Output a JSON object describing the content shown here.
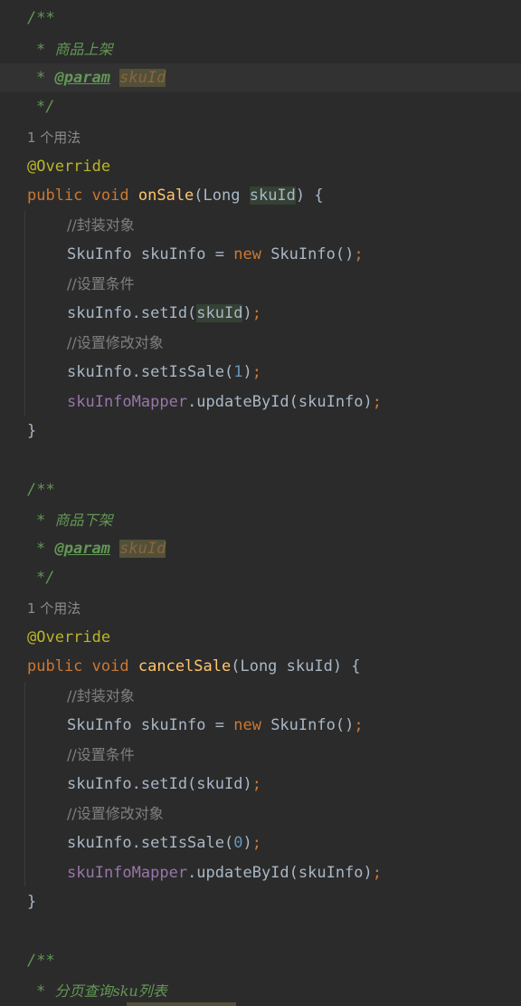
{
  "editor": {
    "block1": {
      "doc_open": "/**",
      "doc_desc": "商品上架",
      "doc_tag": "@param",
      "doc_param": "skuId",
      "doc_close": "*/",
      "usage": "1 个用法",
      "annotation": "@Override",
      "sig_kw1": "public",
      "sig_kw2": "void",
      "sig_name": "onSale",
      "sig_params_pre": "(Long ",
      "sig_param": "skuId",
      "sig_end": ") {",
      "c1": "//封装对象",
      "l1_a": "SkuInfo skuInfo = ",
      "l1_new": "new",
      "l1_b": " SkuInfo()",
      "c2": "//设置条件",
      "l2_a": "skuInfo.setId(",
      "l2_arg": "skuId",
      "l2_b": ")",
      "c3": "//设置修改对象",
      "l3_a": "skuInfo.setIsSale(",
      "l3_num": "1",
      "l3_b": ")",
      "l4_fld": "skuInfoMapper",
      "l4_b": ".updateById(skuInfo)",
      "close": "}"
    },
    "block2": {
      "doc_open": "/**",
      "doc_desc": "商品下架",
      "doc_tag": "@param",
      "doc_param": "skuId",
      "doc_close": "*/",
      "usage": "1 个用法",
      "annotation": "@Override",
      "sig_kw1": "public",
      "sig_kw2": "void",
      "sig_name": "cancelSale",
      "sig_rest": "(Long skuId) {",
      "c1": "//封装对象",
      "l1_a": "SkuInfo skuInfo = ",
      "l1_new": "new",
      "l1_b": " SkuInfo()",
      "c2": "//设置条件",
      "l2": "skuInfo.setId(skuId)",
      "c3": "//设置修改对象",
      "l3_a": "skuInfo.setIsSale(",
      "l3_num": "0",
      "l3_b": ")",
      "l4_fld": "skuInfoMapper",
      "l4_b": ".updateById(skuInfo)",
      "close": "}"
    },
    "block3": {
      "doc_open": "/**",
      "doc_desc": "分页查询sku列表"
    },
    "star": "*",
    "semicolon": ";"
  }
}
